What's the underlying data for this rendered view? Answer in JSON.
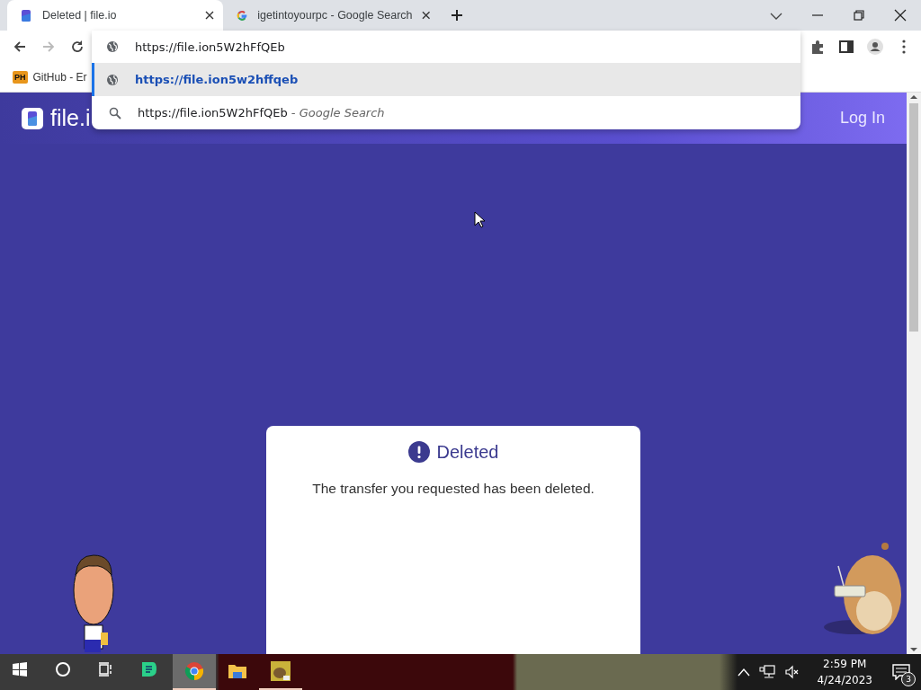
{
  "browser": {
    "tabs": [
      {
        "title": "Deleted | file.io",
        "kind": "fileio",
        "selected": true
      },
      {
        "title": "igetintoyourpc - Google Search",
        "kind": "google",
        "selected": false
      }
    ],
    "omnibox": {
      "value": "https://file.ion5W2hFfQEb"
    },
    "suggestions": [
      {
        "kind": "url",
        "text": "https://file.ion5w2hffqeb",
        "selected": true
      },
      {
        "kind": "search",
        "text": "https://file.ion5W2hFfQEb",
        "suffix": "- Google Search",
        "selected": false
      }
    ],
    "bookmarks": [
      {
        "badge": "PH",
        "label": "GitHub - Er"
      }
    ]
  },
  "page": {
    "logo": "file.i",
    "nav": [
      "Log In"
    ],
    "card": {
      "title": "Deleted",
      "message": "The transfer you requested has been deleted."
    }
  },
  "taskbar": {
    "apps": [
      {
        "kind": "start",
        "active": false,
        "running": false
      },
      {
        "kind": "search",
        "active": false,
        "running": false
      },
      {
        "kind": "taskview",
        "active": false,
        "running": false
      },
      {
        "kind": "chat",
        "active": false,
        "running": false
      },
      {
        "kind": "chrome",
        "active": true,
        "running": true
      },
      {
        "kind": "folder",
        "active": false,
        "running": false
      },
      {
        "kind": "game",
        "active": false,
        "running": true
      }
    ],
    "clock": {
      "time": "2:59 PM",
      "date": "4/24/2023"
    },
    "notifications": {
      "count": "3"
    }
  }
}
